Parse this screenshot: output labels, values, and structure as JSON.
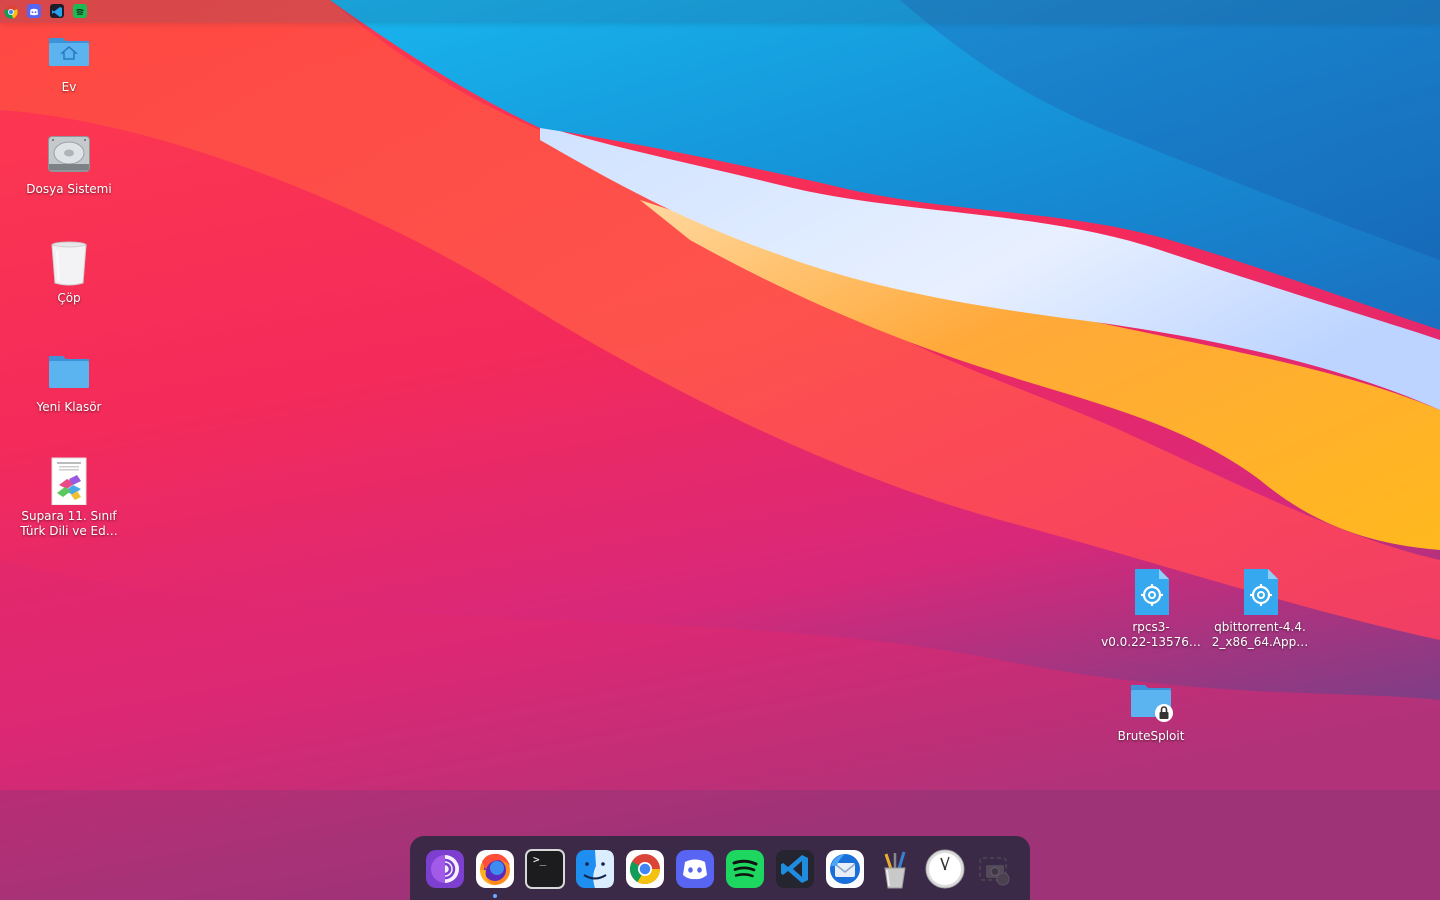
{
  "desktop": {
    "left_items": [
      {
        "label": "Ev",
        "icon": "home-folder-icon"
      },
      {
        "label": "Dosya Sistemi",
        "icon": "hard-drive-icon"
      },
      {
        "label": "Çöp",
        "icon": "trash-icon"
      },
      {
        "label": "Yeni Klasör",
        "icon": "folder-icon"
      },
      {
        "label_line1": "Supara 11. Sınıf",
        "label_line2": "Türk Dili ve Ed…",
        "icon": "document-thumbnail-icon"
      }
    ],
    "right_items": [
      {
        "label_line1": "rpcs3-",
        "label_line2": "v0.0.22-13576…",
        "icon": "appimage-gear-icon"
      },
      {
        "label_line1": "qbittorrent-4.4.",
        "label_line2": "2_x86_64.App…",
        "icon": "appimage-gear-icon"
      },
      {
        "label": "BruteSploit",
        "icon": "locked-folder-icon"
      }
    ]
  },
  "topbar": {
    "tray": [
      "chrome-icon",
      "discord-icon",
      "vscode-icon",
      "spotify-icon"
    ]
  },
  "dock": {
    "apps": [
      {
        "name": "tor-browser",
        "running": false
      },
      {
        "name": "firefox",
        "running": true
      },
      {
        "name": "terminal",
        "running": false
      },
      {
        "name": "finder",
        "running": false
      },
      {
        "name": "chrome",
        "running": false
      },
      {
        "name": "discord",
        "running": false
      },
      {
        "name": "spotify",
        "running": false
      },
      {
        "name": "vscode",
        "running": false
      },
      {
        "name": "thunderbird",
        "running": false
      },
      {
        "name": "pencil-cup",
        "running": false
      },
      {
        "name": "clock",
        "running": false
      },
      {
        "name": "screenshot",
        "running": false
      }
    ],
    "terminal_prompt": ">_"
  },
  "colors": {
    "folder_blue": "#4aa6e8",
    "dock_bg": "#2d2841",
    "running_dot": "#6fa8ff"
  }
}
